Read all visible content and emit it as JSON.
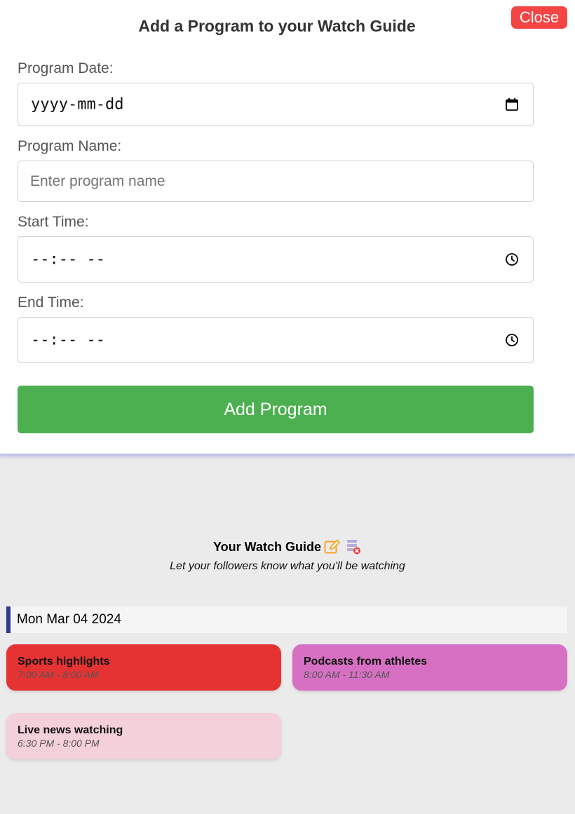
{
  "modal": {
    "title": "Add a Program to your Watch Guide",
    "close_label": "Close",
    "fields": {
      "date": {
        "label": "Program Date:",
        "value": "yyyy-mm-dd",
        "icon": "calendar-icon"
      },
      "name": {
        "label": "Program Name:",
        "placeholder": "Enter program name",
        "value": ""
      },
      "start": {
        "label": "Start Time:",
        "value": "--:-- --",
        "icon": "clock-icon"
      },
      "end": {
        "label": "End Time:",
        "value": "--:-- --",
        "icon": "clock-icon"
      }
    },
    "submit_label": "Add Program",
    "colors": {
      "close": "#f44444",
      "submit": "#4caf50"
    }
  },
  "guide": {
    "title": "Your Watch Guide",
    "subtitle": "Let your followers know what you'll be watching",
    "icons": [
      "edit-icon",
      "delete-list-icon"
    ],
    "date_heading": "Mon Mar 04 2024",
    "programs": [
      {
        "name": "Sports highlights",
        "time": "7:00 AM - 8:00 AM",
        "color": "#e53333"
      },
      {
        "name": "Podcasts from athletes",
        "time": "8:00 AM - 11:30 AM",
        "color": "#d770c3"
      },
      {
        "name": "Live news watching",
        "time": "6:30 PM - 8:00 PM",
        "color": "#f4d0da"
      }
    ]
  }
}
